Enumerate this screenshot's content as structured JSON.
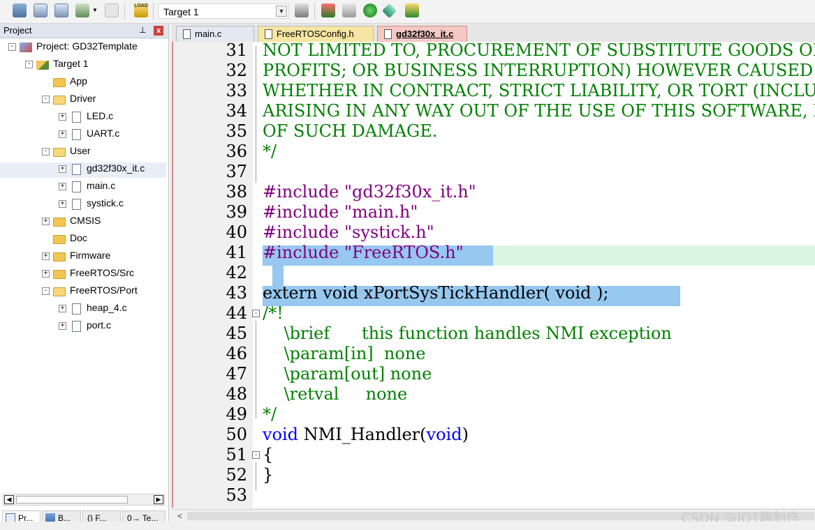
{
  "toolbar": {
    "target_select_value": "Target 1",
    "icons": [
      "rebuild-icon",
      "build-icon",
      "batch-build-icon",
      "manage-icon",
      "translate-icon",
      "load-icon",
      "options-icon",
      "project-manage-icon",
      "pack-installer-icon",
      "component-icon",
      "settings-icon",
      "debug-icon"
    ]
  },
  "project_panel": {
    "title": "Project",
    "pin": "\u0004",
    "close": "x",
    "tree": [
      {
        "label": "Project: GD32Template",
        "level": 0,
        "type": "project",
        "expander": "-"
      },
      {
        "label": "Target 1",
        "level": 1,
        "type": "target",
        "expander": "-"
      },
      {
        "label": "App",
        "level": 2,
        "type": "folder",
        "expander": ""
      },
      {
        "label": "Driver",
        "level": 2,
        "type": "folder-open",
        "expander": "-"
      },
      {
        "label": "LED.c",
        "level": 3,
        "type": "file",
        "expander": "+"
      },
      {
        "label": "UART.c",
        "level": 3,
        "type": "file",
        "expander": "+"
      },
      {
        "label": "User",
        "level": 2,
        "type": "folder-open",
        "expander": "-"
      },
      {
        "label": "gd32f30x_it.c",
        "level": 3,
        "type": "file",
        "expander": "+",
        "selected": true
      },
      {
        "label": "main.c",
        "level": 3,
        "type": "file",
        "expander": "+"
      },
      {
        "label": "systick.c",
        "level": 3,
        "type": "file",
        "expander": "+"
      },
      {
        "label": "CMSIS",
        "level": 2,
        "type": "folder",
        "expander": "+"
      },
      {
        "label": "Doc",
        "level": 2,
        "type": "folder",
        "expander": ""
      },
      {
        "label": "Firmware",
        "level": 2,
        "type": "folder",
        "expander": "+"
      },
      {
        "label": "FreeRTOS/Src",
        "level": 2,
        "type": "folder",
        "expander": "+"
      },
      {
        "label": "FreeRTOS/Port",
        "level": 2,
        "type": "folder-open",
        "expander": "-"
      },
      {
        "label": "heap_4.c",
        "level": 3,
        "type": "file",
        "expander": "+"
      },
      {
        "label": "port.c",
        "level": 3,
        "type": "file",
        "expander": "+"
      }
    ],
    "bottom_tabs": [
      "Pr...",
      "B...",
      "{} F...",
      "0→ Te..."
    ]
  },
  "editor": {
    "tabs": [
      "main.c",
      "FreeRTOSConfig.h",
      "gd32f30x_it.c"
    ],
    "active_tab": "gd32f30x_it.c",
    "lines": [
      {
        "n": "31",
        "fold": "",
        "segs": [
          [
            "comment",
            "NOT LIMITED TO, PROCUREMENT OF SUBSTITUTE GOODS OR SE"
          ]
        ]
      },
      {
        "n": "32",
        "fold": "",
        "segs": [
          [
            "comment",
            "PROFITS; OR BUSINESS INTERRUPTION) HOWEVER CAUSED AND"
          ]
        ]
      },
      {
        "n": "33",
        "fold": "",
        "segs": [
          [
            "comment",
            "WHETHER IN CONTRACT, STRICT LIABILITY, OR TORT (INCLU"
          ]
        ]
      },
      {
        "n": "34",
        "fold": "",
        "segs": [
          [
            "comment",
            "ARISING IN ANY WAY OUT OF THE USE OF THIS SOFTWARE, E"
          ]
        ]
      },
      {
        "n": "35",
        "fold": "",
        "segs": [
          [
            "comment",
            "OF SUCH DAMAGE."
          ]
        ]
      },
      {
        "n": "36",
        "fold": "",
        "segs": [
          [
            "comment",
            "*/"
          ]
        ]
      },
      {
        "n": "37",
        "fold": "",
        "segs": []
      },
      {
        "n": "38",
        "fold": "",
        "segs": [
          [
            "pre",
            "#include \"gd32f30x_it.h\""
          ]
        ]
      },
      {
        "n": "39",
        "fold": "",
        "segs": [
          [
            "pre",
            "#include \"main.h\""
          ]
        ]
      },
      {
        "n": "40",
        "fold": "",
        "segs": [
          [
            "pre",
            "#include \"systick.h\""
          ]
        ]
      },
      {
        "n": "41",
        "fold": "",
        "segs": [
          [
            "pre",
            "#include \"FreeRTOS.h\""
          ]
        ]
      },
      {
        "n": "42",
        "fold": "",
        "segs": []
      },
      {
        "n": "43",
        "fold": "",
        "segs": [
          [
            "plain",
            "extern void xPortSysTickHandler( void );"
          ]
        ]
      },
      {
        "n": "44",
        "fold": "-",
        "segs": [
          [
            "comment",
            "/*!"
          ]
        ]
      },
      {
        "n": "45",
        "fold": "",
        "segs": [
          [
            "comment",
            "    \\brief      this function handles NMI exception"
          ]
        ]
      },
      {
        "n": "46",
        "fold": "",
        "segs": [
          [
            "comment",
            "    \\param[in]  none"
          ]
        ]
      },
      {
        "n": "47",
        "fold": "",
        "segs": [
          [
            "comment",
            "    \\param[out] none"
          ]
        ]
      },
      {
        "n": "48",
        "fold": "",
        "segs": [
          [
            "comment",
            "    \\retval     none"
          ]
        ]
      },
      {
        "n": "49",
        "fold": "",
        "segs": [
          [
            "comment",
            "*/"
          ]
        ]
      },
      {
        "n": "50",
        "fold": "",
        "segs": [
          [
            "kw",
            "void"
          ],
          [
            "plain",
            " NMI_Handler("
          ],
          [
            "kw",
            "void"
          ],
          [
            "plain",
            ")"
          ]
        ]
      },
      {
        "n": "51",
        "fold": "-",
        "segs": [
          [
            "plain",
            "{"
          ]
        ]
      },
      {
        "n": "52",
        "fold": "",
        "segs": [
          [
            "plain",
            "}"
          ]
        ]
      },
      {
        "n": "53",
        "fold": "",
        "segs": []
      }
    ]
  },
  "watermark": "CSDN @IOT趣制作",
  "colors": {
    "comment": "#008000",
    "preprocessor": "#800080",
    "keyword": "#0000ff",
    "selection": "#96c8f0",
    "current_line": "#dbf6e0"
  }
}
